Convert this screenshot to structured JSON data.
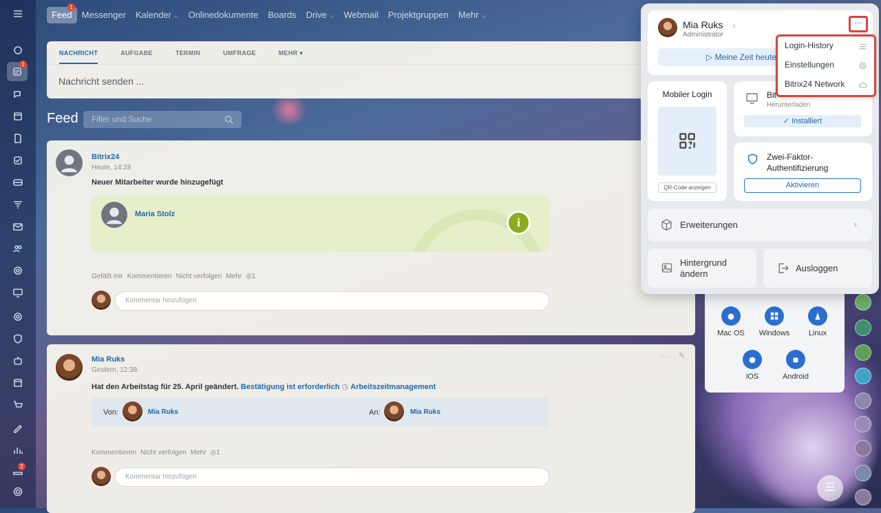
{
  "topnav": {
    "items": [
      "Feed",
      "Messenger",
      "Kalender",
      "Onlinedokumente",
      "Boards",
      "Drive",
      "Webmail",
      "Projektgruppen",
      "Mehr"
    ],
    "feed_badge": "1"
  },
  "leftnav": {
    "badge_feed": "1",
    "badge_bottom": "2"
  },
  "composer": {
    "tabs": [
      "NACHRICHT",
      "AUFGABE",
      "TERMIN",
      "UMFRAGE",
      "MEHR"
    ],
    "placeholder": "Nachricht senden ..."
  },
  "feed": {
    "title": "Feed",
    "filter_placeholder": "Filter und Suche"
  },
  "post1": {
    "author": "Bitrix24",
    "time": "Heute, 14:28",
    "text": "Neuer Mitarbeiter wurde hinzugefügt",
    "employee": "Maria Stolz",
    "actions": [
      "Gefällt mir",
      "Kommentieren",
      "Nicht verfolgen",
      "Mehr"
    ],
    "views": "1",
    "comment_placeholder": "Kommentar hinzufügen"
  },
  "post2": {
    "author": "Mia Ruks",
    "time": "Gestern, 12:38",
    "text": "Hat den Arbeitstag für 25. April geändert.",
    "link1": "Bestätigung ist erforderlich",
    "link2": "Arbeitszeitmanagement",
    "from_label": "Von:",
    "from_name": "Mia Ruks",
    "to_label": "An:",
    "to_name": "Mia Ruks",
    "actions": [
      "Kommentieren",
      "Nicht verfolgen",
      "Mehr"
    ],
    "views": "1",
    "comment_placeholder": "Kommentar hinzufügen"
  },
  "panel": {
    "user_name": "Mia Ruks",
    "user_role": "Administrator",
    "worktime_button": "Meine Zeit heute",
    "menu": [
      "Login-History",
      "Einstellungen",
      "Bitrix24 Network"
    ],
    "mobile_login_title": "Mobiler Login",
    "qr_button": "QR-Code anzeigen",
    "desktop_title": "Bit",
    "desktop_sub": "Herunterladen",
    "installed": "Installiert",
    "twofa_title": "Zwei-Faktor-Authentifizierung",
    "activate": "Aktivieren",
    "extensions": "Erweiterungen",
    "background": "Hintergrund ändern",
    "logout": "Ausloggen"
  },
  "downloads": {
    "items": [
      "Mac OS",
      "Windows",
      "Linux",
      "iOS",
      "Android"
    ]
  },
  "colors": {
    "accent": "#2067b0",
    "highlight": "#d9433c",
    "badge": "#e8452f"
  }
}
